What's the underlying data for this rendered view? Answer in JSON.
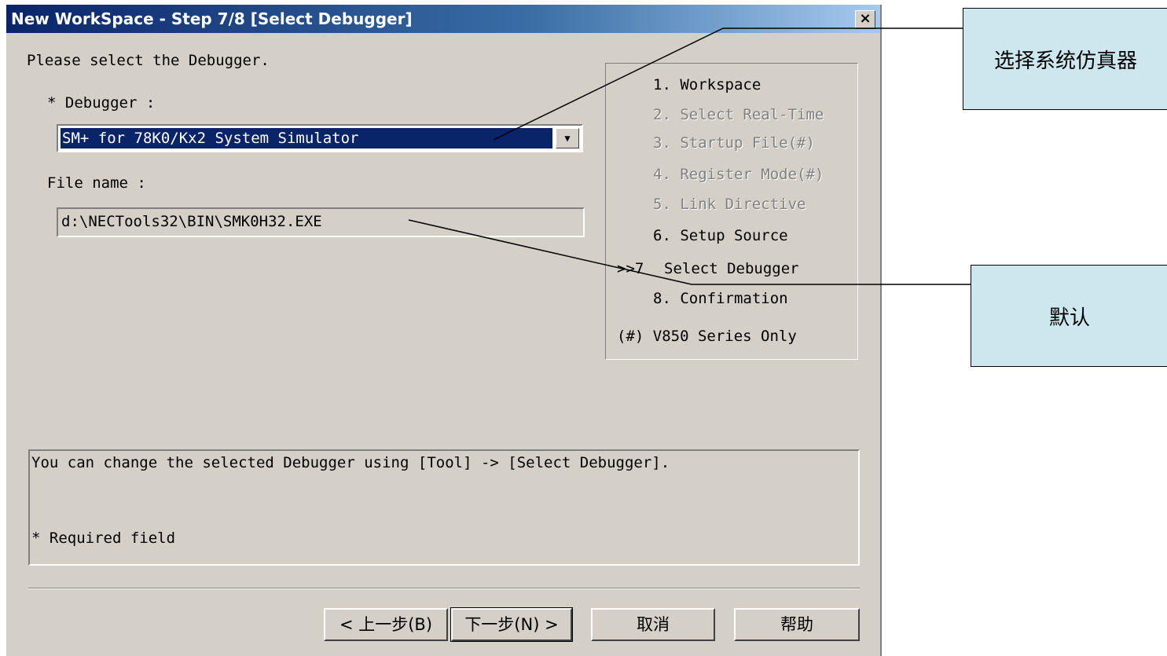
{
  "window": {
    "title": "New WorkSpace - Step 7/8 [Select Debugger]",
    "close_label": "×"
  },
  "main": {
    "instruction": "Please select the Debugger.",
    "debugger_label": "* Debugger :",
    "debugger_value": "SM+ for 78K0/Kx2 System Simulator",
    "dropdown_arrow": "▼",
    "file_label": "File name :",
    "file_value": "d:\\NECTools32\\BIN\\SMK0H32.EXE"
  },
  "steps": [
    {
      "label": "1. Workspace",
      "state": "done"
    },
    {
      "label": "2. Select Real-Time",
      "state": "disabled"
    },
    {
      "label": "3. Startup File(#)",
      "state": "disabled"
    },
    {
      "label": "4. Register Mode(#)",
      "state": "disabled"
    },
    {
      "label": "5. Link Directive",
      "state": "disabled"
    },
    {
      "label": "6. Setup Source",
      "state": "done"
    },
    {
      "label": "Select Debugger",
      "state": "current",
      "marker": ">>7"
    },
    {
      "label": "8. Confirmation",
      "state": "pending"
    }
  ],
  "steps_note": "(#) V850 Series Only",
  "info": {
    "line1": "You can change the selected Debugger using [Tool] -> [Select Debugger].",
    "line2": "* Required field"
  },
  "buttons": {
    "back": "< 上一步(B)",
    "next": "下一步(N) >",
    "cancel": "取消",
    "help": "帮助"
  },
  "callouts": {
    "select_simulator": "选择系统仿真器",
    "default": "默认"
  },
  "colors": {
    "title_start": "#0a246a",
    "selection": "#0a246a",
    "dialog_bg": "#d4d0c8",
    "callout_bg": "#cce8ee"
  }
}
